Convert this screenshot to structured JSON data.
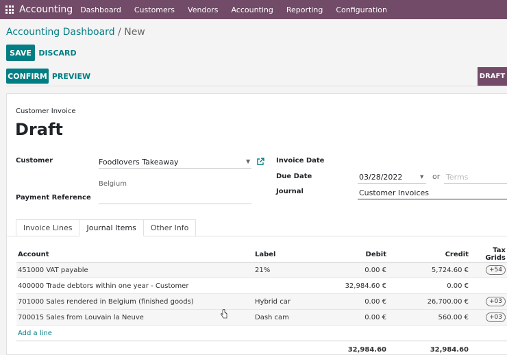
{
  "topbar": {
    "app_name": "Accounting",
    "menu": [
      "Dashboard",
      "Customers",
      "Vendors",
      "Accounting",
      "Reporting",
      "Configuration"
    ]
  },
  "breadcrumb": {
    "parent": "Accounting Dashboard",
    "sep": " / ",
    "current": "New"
  },
  "actions": {
    "save": "SAVE",
    "discard": "DISCARD",
    "confirm": "CONFIRM",
    "preview": "PREVIEW",
    "status": "DRAFT"
  },
  "form": {
    "type_label": "Customer Invoice",
    "title": "Draft",
    "customer_label": "Customer",
    "customer_value": "Foodlovers Takeaway",
    "customer_address": "Belgium",
    "payment_ref_label": "Payment Reference",
    "invoice_date_label": "Invoice Date",
    "due_date_label": "Due Date",
    "due_date_value": "03/28/2022",
    "or": "or",
    "terms_placeholder": "Terms",
    "journal_label": "Journal",
    "journal_value": "Customer Invoices"
  },
  "tabs": [
    "Invoice Lines",
    "Journal Items",
    "Other Info"
  ],
  "table": {
    "headers": [
      "Account",
      "Label",
      "Debit",
      "Credit",
      "Tax Grids"
    ],
    "rows": [
      {
        "account": "451000 VAT payable",
        "label": "21%",
        "debit": "0.00 €",
        "credit": "5,724.60 €",
        "grid": "+54"
      },
      {
        "account": "400000 Trade debtors within one year - Customer",
        "label": "",
        "debit": "32,984.60 €",
        "credit": "0.00 €",
        "grid": ""
      },
      {
        "account": "701000 Sales rendered in Belgium (finished goods)",
        "label": "Hybrid car",
        "debit": "0.00 €",
        "credit": "26,700.00 €",
        "grid": "+03"
      },
      {
        "account": "700015 Sales from Louvain la Neuve",
        "label": "Dash cam",
        "debit": "0.00 €",
        "credit": "560.00 €",
        "grid": "+03"
      }
    ],
    "add_line": "Add a line",
    "total_debit": "32,984.60",
    "total_credit": "32,984.60"
  },
  "colors": {
    "brand": "#714b67",
    "accent": "#017e84"
  }
}
